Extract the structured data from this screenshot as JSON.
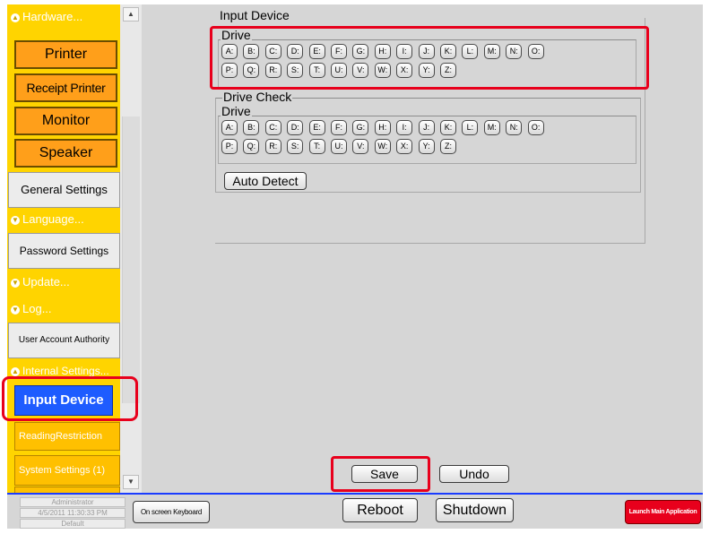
{
  "sidebar": {
    "hardware_header": "Hardware...",
    "hardware_items": [
      "Printer",
      "Receipt Printer",
      "Monitor",
      "Speaker"
    ],
    "general_settings": "General Settings",
    "language_header": "Language...",
    "password_settings": "Password Settings",
    "update_header": "Update...",
    "log_header": "Log...",
    "user_account_authority": "User Account Authority",
    "internal_settings_header": "Internal Settings...",
    "input_device": "Input Device",
    "reading_restriction": "ReadingRestriction",
    "system_settings": "System Settings (1)"
  },
  "main": {
    "section_title": "Input Device",
    "drive_group_label": "Drive",
    "drive_keys": [
      "A:",
      "B:",
      "C:",
      "D:",
      "E:",
      "F:",
      "G:",
      "H:",
      "I:",
      "J:",
      "K:",
      "L:",
      "M:",
      "N:",
      "O:",
      "P:",
      "Q:",
      "R:",
      "S:",
      "T:",
      "U:",
      "V:",
      "W:",
      "X:",
      "Y:",
      "Z:"
    ],
    "drive_check_label": "Drive Check",
    "drive_check_drive_label": "Drive",
    "auto_detect_label": "Auto Detect",
    "save_label": "Save",
    "undo_label": "Undo"
  },
  "bottom_bar": {
    "user": "Administrator",
    "datetime": "4/5/2011 11:30:33 PM",
    "profile": "Default",
    "on_screen_keyboard": "On screen Keyboard",
    "reboot": "Reboot",
    "shutdown": "Shutdown",
    "launch_main_application": "Launch Main Application"
  },
  "colors": {
    "sidebar_bg": "#ffd400",
    "hardware_button": "#ff9f1a",
    "selected_item": "#1e5cff",
    "annotation_red": "#e8001c",
    "launch_button": "#e8001c",
    "bottom_bar_line": "#1a3cff"
  }
}
